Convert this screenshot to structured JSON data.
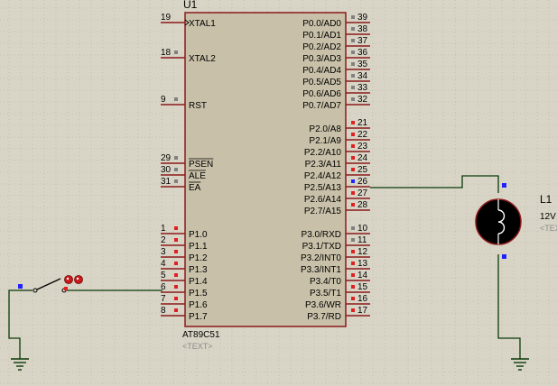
{
  "schematic": {
    "mcu": {
      "ref": "U1",
      "part": "AT89C51",
      "text_placeholder": "<TEXT>",
      "left_pins": [
        {
          "num": "19",
          "label": "XTAL1",
          "clock": true
        },
        {
          "num": "18",
          "label": "XTAL2"
        },
        {
          "num": "9",
          "label": "RST"
        },
        {
          "num": "29",
          "label": "PSEN",
          "overline": true
        },
        {
          "num": "30",
          "label": "ALE",
          "overline": true
        },
        {
          "num": "31",
          "label": "EA",
          "overline": true
        },
        {
          "num": "1",
          "label": "P1.0"
        },
        {
          "num": "2",
          "label": "P1.1"
        },
        {
          "num": "3",
          "label": "P1.2"
        },
        {
          "num": "4",
          "label": "P1.3"
        },
        {
          "num": "5",
          "label": "P1.4"
        },
        {
          "num": "6",
          "label": "P1.5"
        },
        {
          "num": "7",
          "label": "P1.6"
        },
        {
          "num": "8",
          "label": "P1.7"
        }
      ],
      "right_pins": [
        {
          "num": "39",
          "label": "P0.0/AD0"
        },
        {
          "num": "38",
          "label": "P0.1/AD1"
        },
        {
          "num": "37",
          "label": "P0.2/AD2"
        },
        {
          "num": "36",
          "label": "P0.3/AD3"
        },
        {
          "num": "35",
          "label": "P0.4/AD4"
        },
        {
          "num": "34",
          "label": "P0.5/AD5"
        },
        {
          "num": "33",
          "label": "P0.6/AD6"
        },
        {
          "num": "32",
          "label": "P0.7/AD7"
        },
        {
          "num": "21",
          "label": "P2.0/A8"
        },
        {
          "num": "22",
          "label": "P2.1/A9"
        },
        {
          "num": "23",
          "label": "P2.2/A10"
        },
        {
          "num": "24",
          "label": "P2.3/A11"
        },
        {
          "num": "25",
          "label": "P2.4/A12"
        },
        {
          "num": "26",
          "label": "P2.5/A13"
        },
        {
          "num": "27",
          "label": "P2.6/A14"
        },
        {
          "num": "28",
          "label": "P2.7/A15"
        },
        {
          "num": "10",
          "label": "P3.0/RXD"
        },
        {
          "num": "11",
          "label": "P3.1/TXD"
        },
        {
          "num": "12",
          "label": "P3.2/INT0"
        },
        {
          "num": "13",
          "label": "P3.3/INT1"
        },
        {
          "num": "14",
          "label": "P3.4/T0"
        },
        {
          "num": "15",
          "label": "P3.5/T1"
        },
        {
          "num": "16",
          "label": "P3.6/WR"
        },
        {
          "num": "17",
          "label": "P3.7/RD"
        }
      ]
    },
    "lamp": {
      "ref": "L1",
      "value": "12V",
      "text_placeholder": "<TEXT>"
    },
    "colors": {
      "background": "#d9d5c6",
      "grid_dot": "#b3ad9b",
      "body_fill": "#c8c0a8",
      "outline": "#8b1a1a",
      "wire": "#0a3a0a",
      "pin_red": "#e02020",
      "pin_gray": "#808080",
      "pin_blue": "#2020ff"
    }
  }
}
